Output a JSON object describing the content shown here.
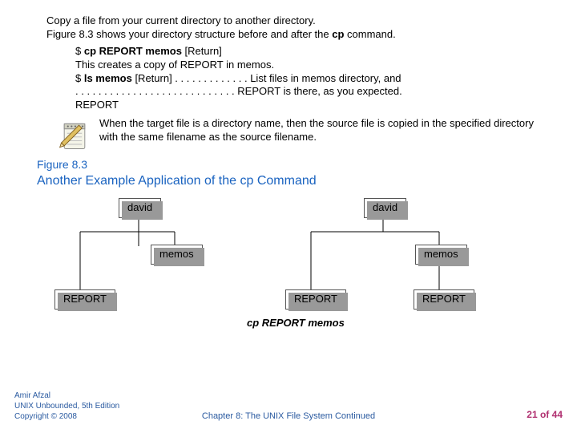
{
  "intro": {
    "line1": "Copy a file from your current directory to another directory.",
    "line2_a": "Figure 8.3 shows your directory structure before and after the ",
    "line2_cmd": "cp",
    "line2_b": " command."
  },
  "cmd": {
    "l1_a": "$ ",
    "l1_b": "cp REPORT memos",
    "l1_c": " [Return]",
    "l2": "This creates a copy of REPORT in memos.",
    "l3_a": "$ ",
    "l3_b": "ls memos",
    "l3_c": " [Return] . . . . . . . . . . . . . List files in memos directory, and",
    "l4": ". . . . . . . . . . . . . . . . . . . . . . . . . . . . REPORT is there, as you expected.",
    "l5": "REPORT"
  },
  "note": "When the target file is a directory name, then the source file is copied in the specified directory with the same filename as the source filename.",
  "figure": {
    "label": "Figure 8.3",
    "title": "Another Example Application of the cp Command",
    "nodes": {
      "david": "david",
      "memos": "memos",
      "report": "REPORT"
    },
    "caption": "cp REPORT memos"
  },
  "footer": {
    "left_l1": "Amir Afzal",
    "left_l2": "UNIX Unbounded, 5th Edition",
    "left_l3": "Copyright © 2008",
    "center": "Chapter 8: The UNIX File System Continued",
    "right_a": "21",
    "right_mid": " of ",
    "right_b": "44"
  }
}
